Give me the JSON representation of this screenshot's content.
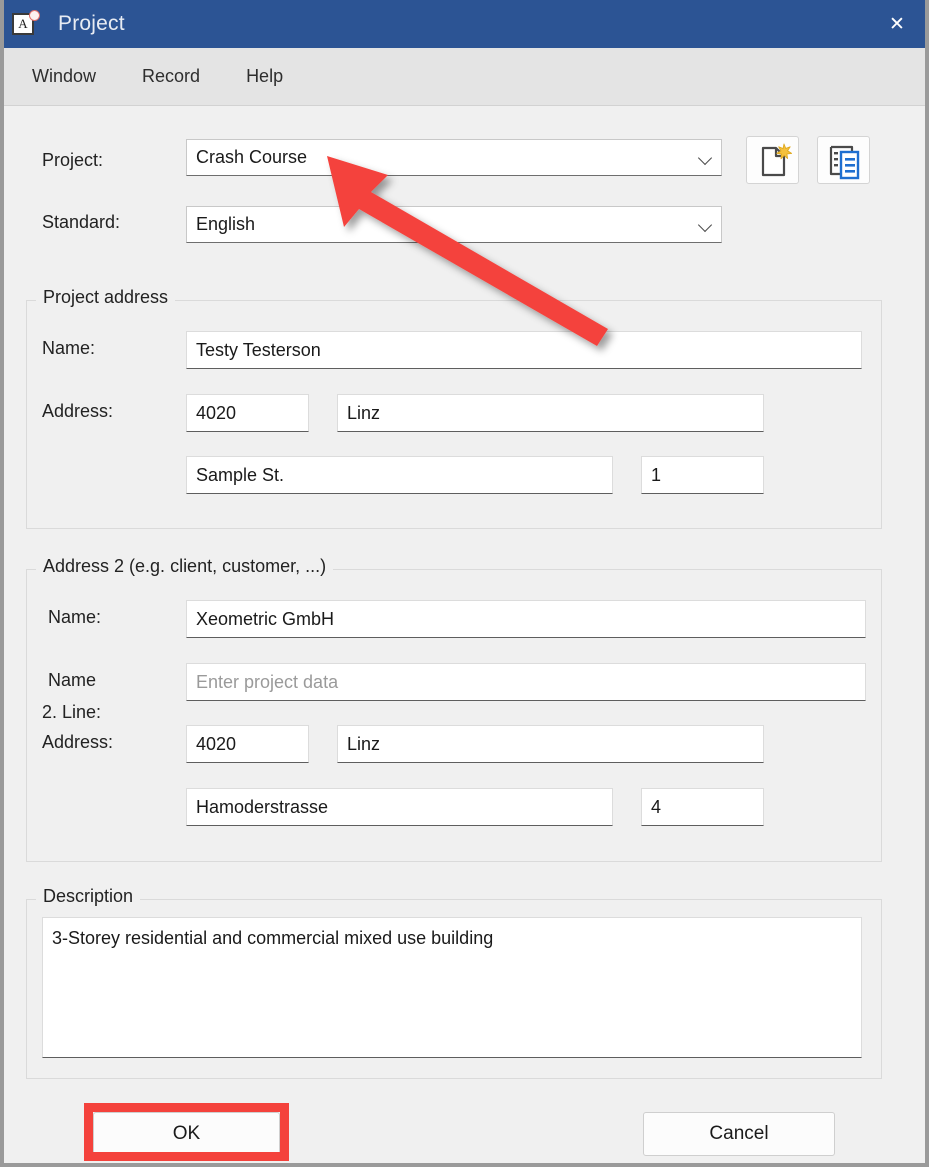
{
  "window": {
    "title": "Project",
    "icon": "app-a-icon",
    "close_label": "✕",
    "titlebar_color": "#2c5494"
  },
  "menubar": {
    "items": [
      {
        "label": "Window"
      },
      {
        "label": "Record"
      },
      {
        "label": "Help"
      }
    ]
  },
  "top_form": {
    "project": {
      "label": "Project:",
      "value": "Crash Course"
    },
    "standard": {
      "label": "Standard:",
      "value": "English"
    },
    "buttons": [
      {
        "name": "new-project-button",
        "icon": "new-document-icon"
      },
      {
        "name": "copy-project-button",
        "icon": "document-list-icon"
      }
    ]
  },
  "project_address": {
    "title": "Project address",
    "name_label": "Name:",
    "name_value": "Testy Testerson",
    "address_label": "Address:",
    "zip_value": "4020",
    "city_value": "Linz",
    "street_value": "Sample St.",
    "number_value": "1"
  },
  "address_2": {
    "title": "Address 2 (e.g. client, customer, ...)",
    "name_label": "Name:",
    "name_value": "Xeometric GmbH",
    "name_line2_label_a": "Name",
    "name_line2_label_b": "2. Line:",
    "name_line2_placeholder": "Enter project data",
    "name_line2_value": "",
    "address_label": "Address:",
    "zip_value": "4020",
    "city_value": "Linz",
    "street_value": "Hamoderstrasse",
    "number_value": "4"
  },
  "description": {
    "title": "Description",
    "value": "3-Storey residential and commercial mixed use building"
  },
  "footer": {
    "ok_label": "OK",
    "cancel_label": "Cancel"
  },
  "annotations": {
    "highlight_color": "#f4423c",
    "arrow_color": "#f4423c",
    "arrow_target": "project-combobox",
    "highlight_target": "ok-button"
  }
}
